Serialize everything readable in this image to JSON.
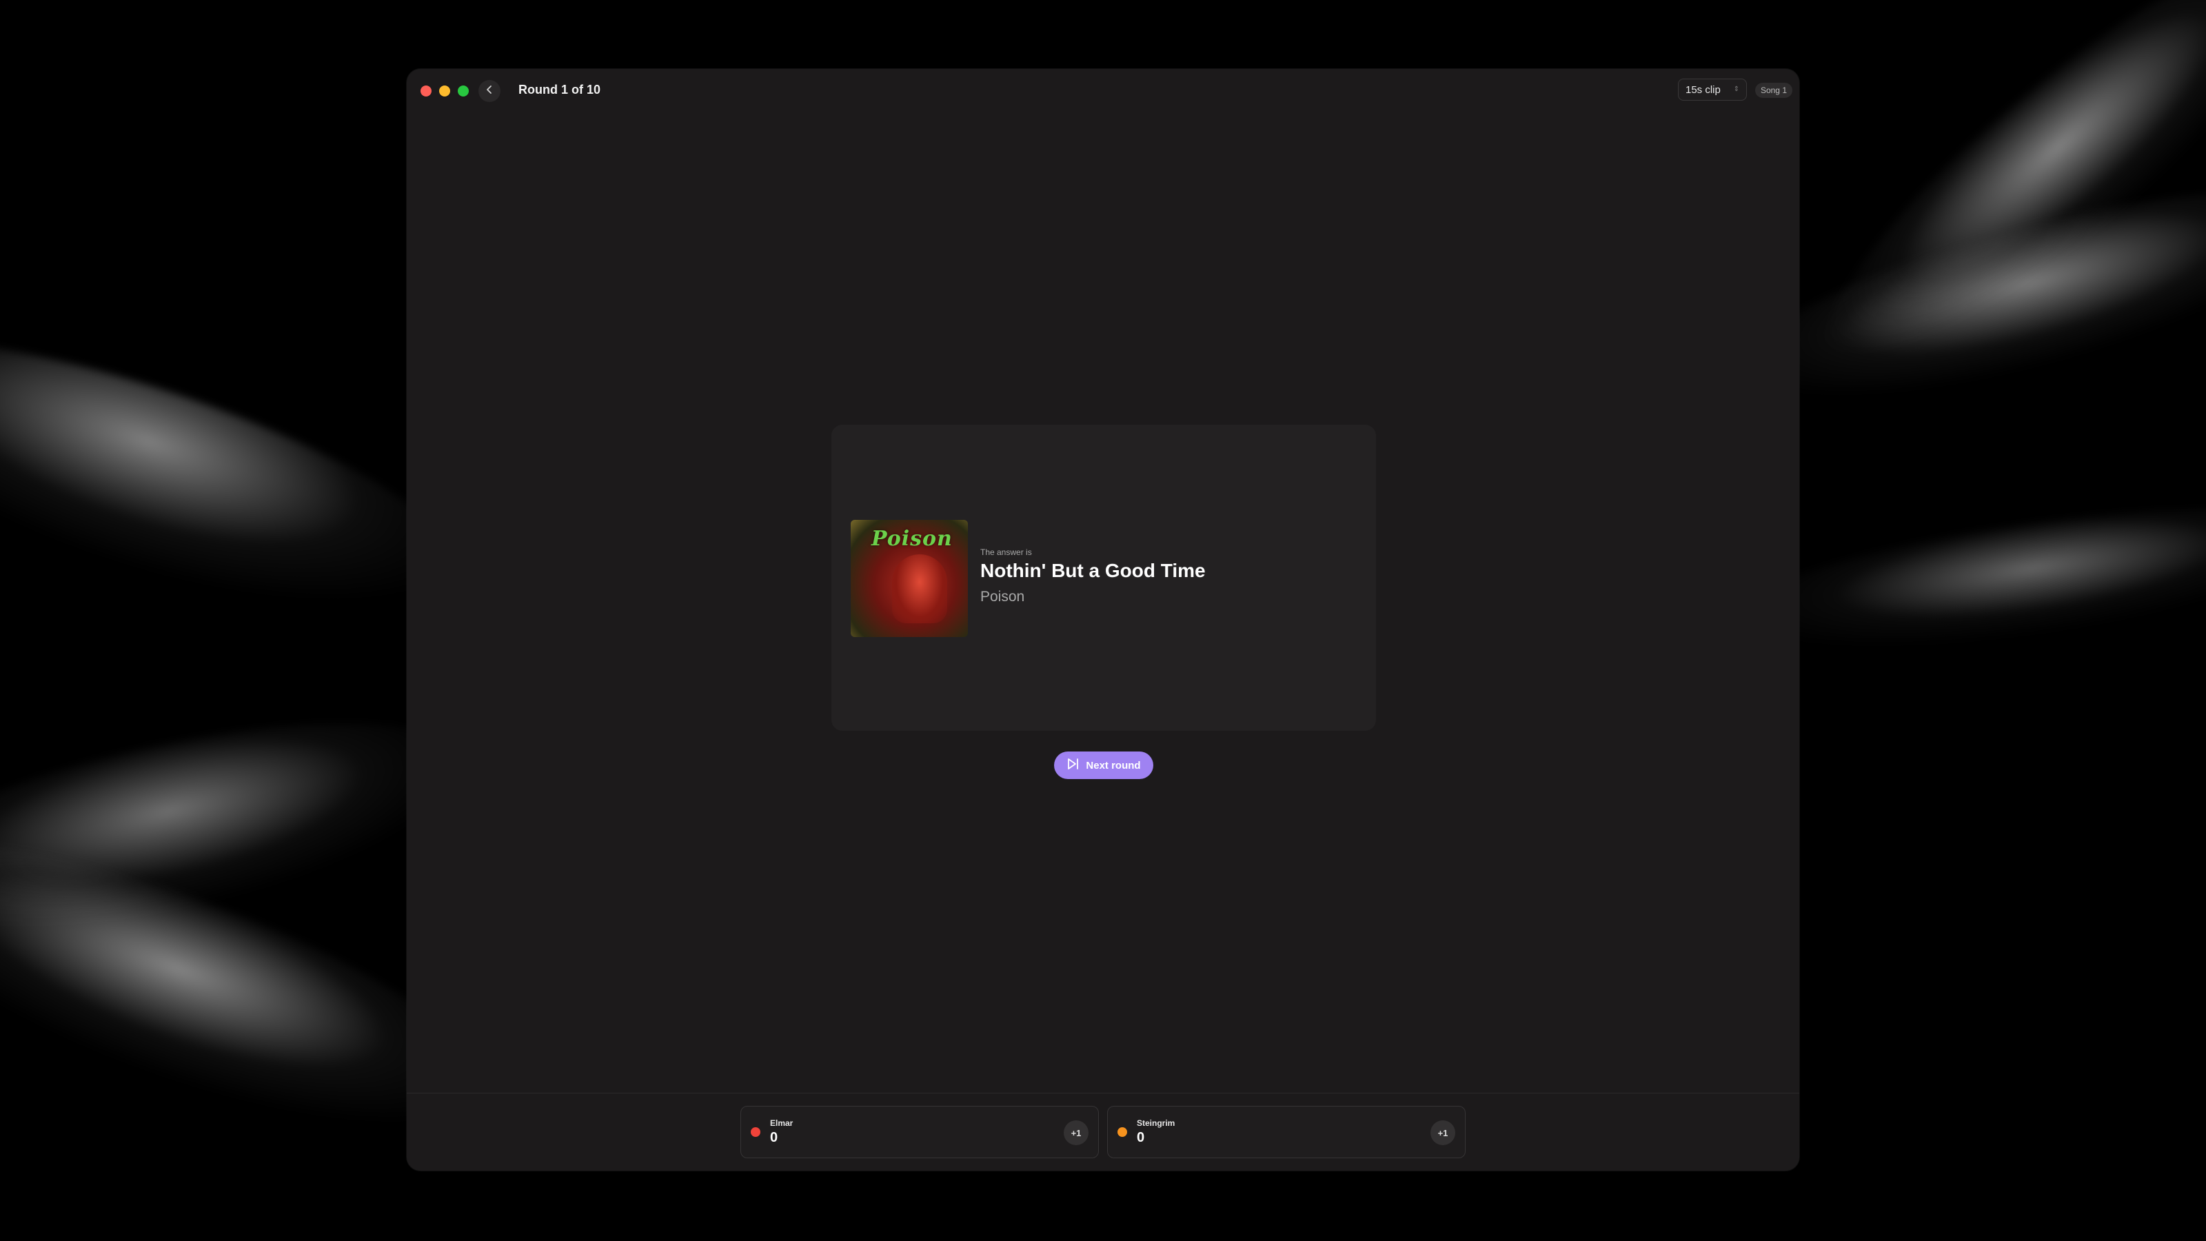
{
  "window": {
    "round_label": "Round 1 of 10",
    "clip_length": "15s clip",
    "song_badge": "Song 1"
  },
  "answer": {
    "intro": "The answer is",
    "title": "Nothin' But a Good Time",
    "artist": "Poison",
    "album_logo_text": "Poison"
  },
  "next_button": {
    "label": "Next round",
    "icon": "skip-forward-icon"
  },
  "players": [
    {
      "name": "Elmar",
      "score": "0",
      "color": "#f1433a",
      "plus_label": "+1"
    },
    {
      "name": "Steingrim",
      "score": "0",
      "color": "#f7931e",
      "plus_label": "+1"
    }
  ],
  "colors": {
    "accent": "#9f82f2",
    "window_bg": "#1c1a1b",
    "card_bg": "#232122"
  }
}
